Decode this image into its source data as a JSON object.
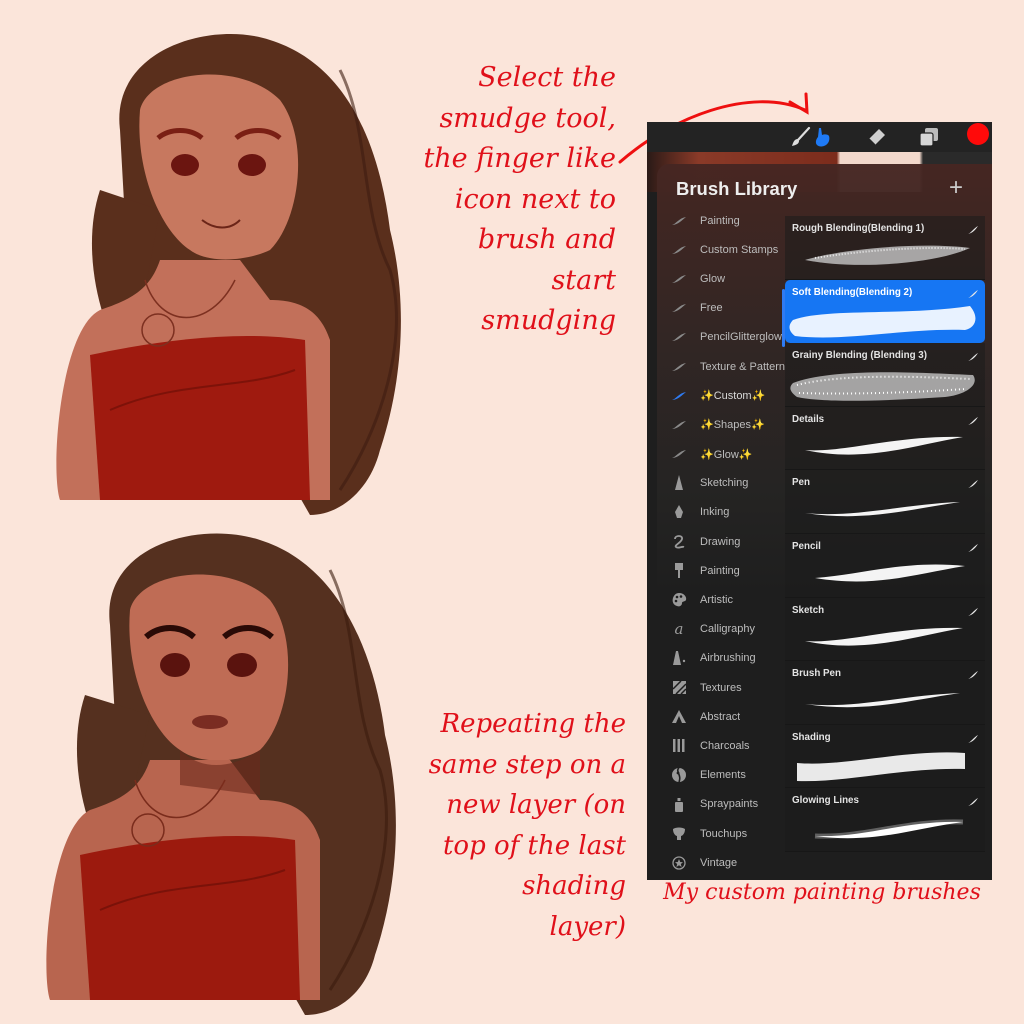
{
  "captions": {
    "top": "Select the\nsmudge tool,\nthe  finger like\nicon next to\nbrush and\nstart\nsmudging",
    "bottom": "Repeating the\nsame step on a\nnew layer (on\ntop of the last\nshading\nlayer)",
    "panel": "My custom painting brushes"
  },
  "colors": {
    "background": "#fbe5da",
    "annotation": "#e0101a",
    "accent": "#1676f3",
    "current_color": "#ff0a0a"
  },
  "toolbar": {
    "tools": [
      {
        "name": "brush",
        "icon": "brush-icon",
        "active": false
      },
      {
        "name": "smudge",
        "icon": "smudge-finger-icon",
        "active": true
      },
      {
        "name": "eraser",
        "icon": "eraser-icon",
        "active": false
      },
      {
        "name": "layers",
        "icon": "layers-icon",
        "active": false
      },
      {
        "name": "color",
        "icon": "color-swatch",
        "active": false
      }
    ]
  },
  "library": {
    "title": "Brush Library",
    "add_label": "+",
    "sets": [
      {
        "label": "Painting",
        "icon": "stroke-thumb",
        "active": false
      },
      {
        "label": "Custom Stamps",
        "icon": "stroke-thumb",
        "active": false
      },
      {
        "label": "Glow",
        "icon": "stroke-thumb",
        "active": false
      },
      {
        "label": "Free",
        "icon": "stroke-thumb",
        "active": false
      },
      {
        "label": "PencilGlitterglow",
        "icon": "stroke-thumb",
        "active": false
      },
      {
        "label": "Texture & Pattern",
        "icon": "stroke-thumb",
        "active": false
      },
      {
        "label": "✨Custom✨",
        "icon": "stroke-thumb",
        "active": true
      },
      {
        "label": "✨Shapes✨",
        "icon": "stroke-thumb",
        "active": false
      },
      {
        "label": "✨Glow✨",
        "icon": "stroke-thumb",
        "active": false
      },
      {
        "label": "Sketching",
        "icon": "sketching-icon",
        "active": false
      },
      {
        "label": "Inking",
        "icon": "inking-icon",
        "active": false
      },
      {
        "label": "Drawing",
        "icon": "drawing-icon",
        "active": false
      },
      {
        "label": "Painting",
        "icon": "painting-icon",
        "active": false
      },
      {
        "label": "Artistic",
        "icon": "palette-icon",
        "active": false
      },
      {
        "label": "Calligraphy",
        "icon": "calligraphy-icon",
        "active": false
      },
      {
        "label": "Airbrushing",
        "icon": "airbrush-icon",
        "active": false
      },
      {
        "label": "Textures",
        "icon": "textures-icon",
        "active": false
      },
      {
        "label": "Abstract",
        "icon": "abstract-icon",
        "active": false
      },
      {
        "label": "Charcoals",
        "icon": "charcoals-icon",
        "active": false
      },
      {
        "label": "Elements",
        "icon": "elements-icon",
        "active": false
      },
      {
        "label": "Spraypaints",
        "icon": "spraypaint-icon",
        "active": false
      },
      {
        "label": "Touchups",
        "icon": "touchups-icon",
        "active": false
      },
      {
        "label": "Vintage",
        "icon": "vintage-icon",
        "active": false
      }
    ],
    "brushes": [
      {
        "name": "Rough Blending(Blending 1)",
        "style": "rough",
        "selected": false
      },
      {
        "name": "Soft Blending(Blending 2)",
        "style": "soft",
        "selected": true
      },
      {
        "name": "Grainy Blending (Blending 3)",
        "style": "grainy",
        "selected": false
      },
      {
        "name": "Details",
        "style": "taper",
        "selected": false
      },
      {
        "name": "Pen",
        "style": "thin",
        "selected": false
      },
      {
        "name": "Pencil",
        "style": "pencil",
        "selected": false
      },
      {
        "name": "Sketch",
        "style": "taper",
        "selected": false
      },
      {
        "name": "Brush Pen",
        "style": "thin",
        "selected": false
      },
      {
        "name": "Shading",
        "style": "shading",
        "selected": false
      },
      {
        "name": "Glowing  Lines",
        "style": "glow",
        "selected": false
      }
    ]
  }
}
